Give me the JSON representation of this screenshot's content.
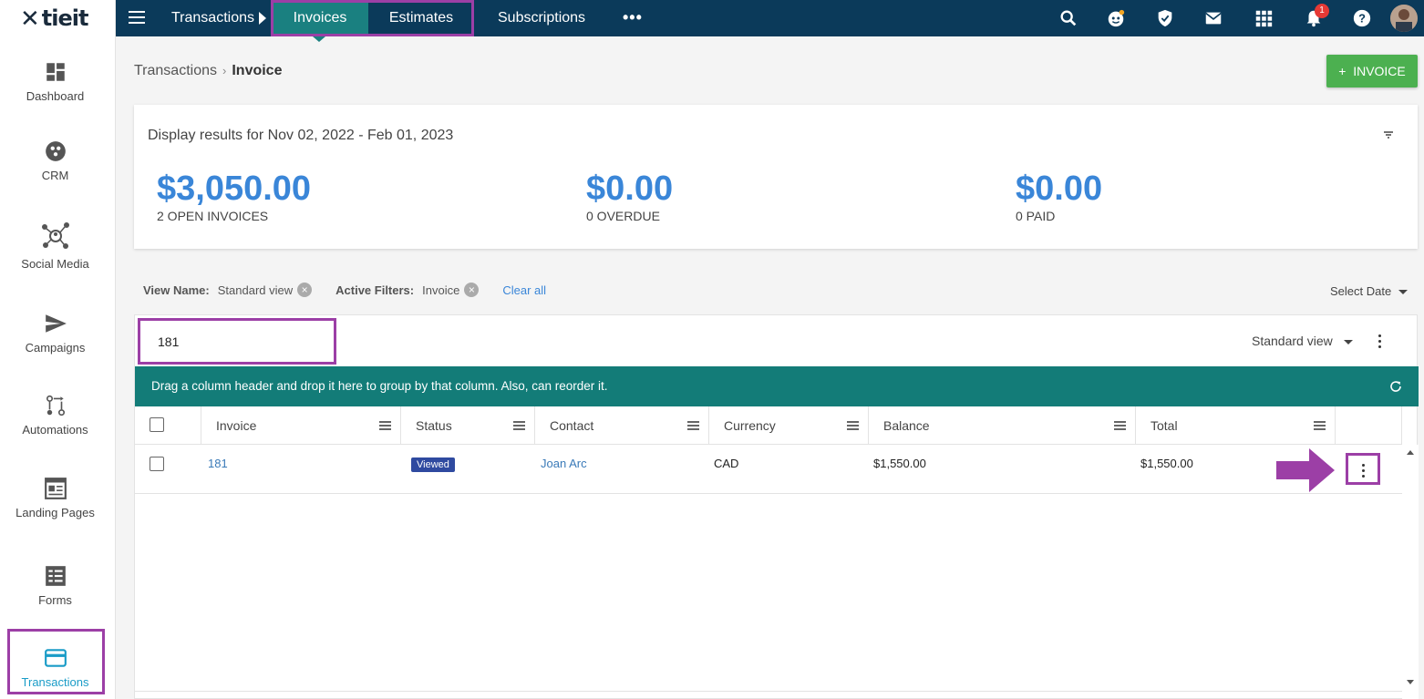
{
  "brand": {
    "logo_text": "tieit"
  },
  "sidebar": {
    "items": [
      {
        "label": "Dashboard",
        "icon": "dashboard-icon"
      },
      {
        "label": "CRM",
        "icon": "crm-icon"
      },
      {
        "label": "Social Media",
        "icon": "social-media-icon"
      },
      {
        "label": "Campaigns",
        "icon": "send-icon"
      },
      {
        "label": "Automations",
        "icon": "automation-icon"
      },
      {
        "label": "Landing Pages",
        "icon": "landing-page-icon"
      },
      {
        "label": "Forms",
        "icon": "forms-icon"
      },
      {
        "label": "Transactions",
        "icon": "credit-card-icon",
        "active": true
      }
    ]
  },
  "topbar": {
    "section": "Transactions",
    "tabs": [
      {
        "label": "Invoices",
        "active": true
      },
      {
        "label": "Estimates"
      },
      {
        "label": "Subscriptions"
      }
    ],
    "more": "•••",
    "notification_count": "1"
  },
  "breadcrumb": {
    "parent": "Transactions",
    "separator": "›",
    "current": "Invoice"
  },
  "add_button": {
    "plus": "+",
    "label": "INVOICE"
  },
  "summary": {
    "title": "Display results for Nov 02, 2022 - Feb 01, 2023",
    "stats": [
      {
        "amount": "$3,050.00",
        "label": "2 OPEN INVOICES"
      },
      {
        "amount": "$0.00",
        "label": "0 OVERDUE"
      },
      {
        "amount": "$0.00",
        "label": "0 PAID"
      }
    ]
  },
  "filters": {
    "view_name_label": "View Name:",
    "view_name_value": "Standard view",
    "active_filters_label": "Active Filters:",
    "active_filters_value": "Invoice",
    "clear_all": "Clear all",
    "select_date": "Select Date"
  },
  "grid": {
    "search_value": "181",
    "view_selector": "Standard view",
    "group_hint": "Drag a column header and drop it here to group by that column. Also, can reorder it.",
    "columns": [
      "Invoice",
      "Status",
      "Contact",
      "Currency",
      "Balance",
      "Total"
    ],
    "rows": [
      {
        "invoice": "181",
        "status": "Viewed",
        "contact": "Joan Arc",
        "currency": "CAD",
        "balance": "$1,550.00",
        "total": "$1,550.00"
      }
    ]
  },
  "colors": {
    "topbar": "#0b3a5a",
    "active_tab": "#1a8080",
    "group_bar": "#137c78",
    "amount": "#3a86d8",
    "add_button": "#4cb050",
    "highlight": "#9c3fa6"
  }
}
